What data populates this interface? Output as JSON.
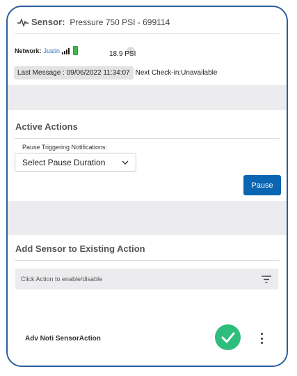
{
  "sensor": {
    "label": "Sensor:",
    "name": "Pressure 750 PSI - 699114",
    "network_label": "Network:",
    "network_name": "Justin",
    "reading": "18.9 PSI",
    "last_message": "Last Message : 09/06/2022 11:34:07",
    "next_checkin": "Next Check-in:Unavailable"
  },
  "active_actions": {
    "title": "Active Actions",
    "pause_label": "Pause Triggering Notifications:",
    "select_value": "Select Pause Duration",
    "pause_button": "Pause"
  },
  "add_sensor": {
    "title": "Add Sensor to Existing Action",
    "filter_placeholder": "Click Action to enable/disable",
    "actions": [
      {
        "name": "Adv Noti SensorAction",
        "enabled": true
      }
    ]
  },
  "colors": {
    "accent": "#0a65b3",
    "enabled": "#2fbd7c",
    "frame": "#2a5d9c"
  }
}
